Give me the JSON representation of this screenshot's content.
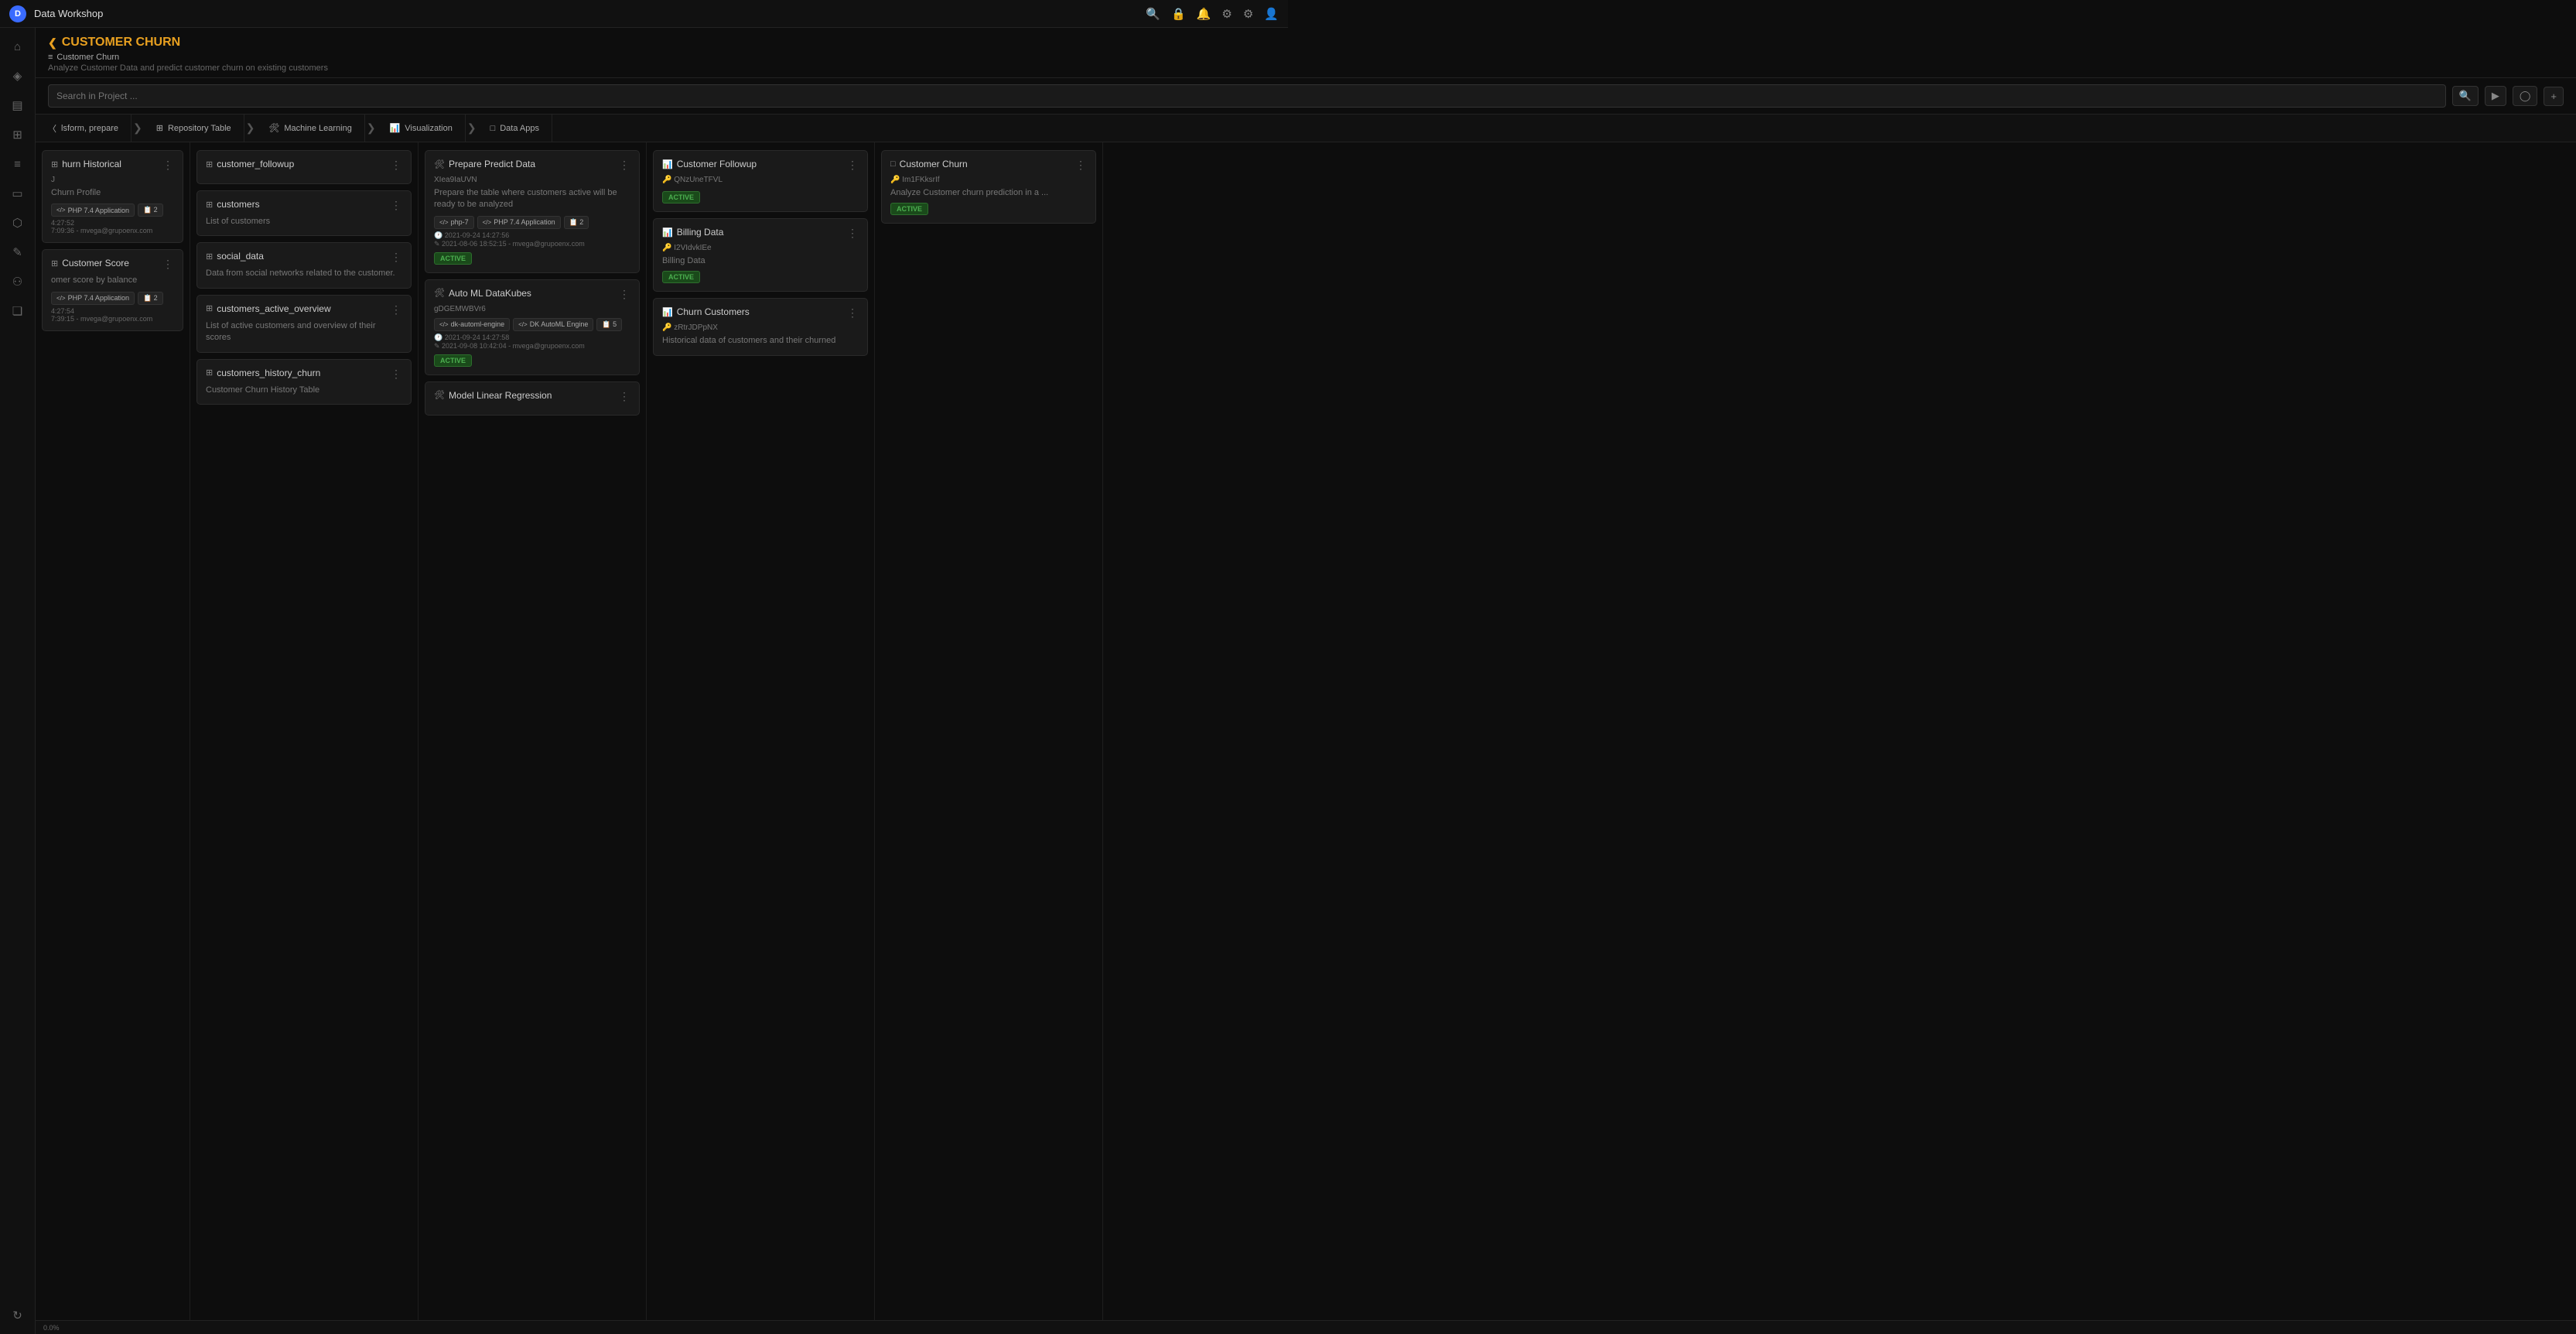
{
  "app": {
    "title": "Data Workshop",
    "logo_letter": "D"
  },
  "topnav": {
    "icons": [
      "search",
      "lock",
      "bell",
      "settings",
      "terminal",
      "user"
    ]
  },
  "sidebar": {
    "items": [
      {
        "name": "home",
        "icon": "⌂"
      },
      {
        "name": "analytics",
        "icon": "◈"
      },
      {
        "name": "storage",
        "icon": "▤"
      },
      {
        "name": "pipelines",
        "icon": "⊞"
      },
      {
        "name": "datasources",
        "icon": "≡"
      },
      {
        "name": "display",
        "icon": "▭"
      },
      {
        "name": "charts",
        "icon": "⬡"
      },
      {
        "name": "tools",
        "icon": "✎"
      },
      {
        "name": "users",
        "icon": "⚇"
      },
      {
        "name": "docs",
        "icon": "❏"
      }
    ]
  },
  "header": {
    "back_label": "CUSTOMER CHURN",
    "project_icon": "≡",
    "project_name": "Customer Churn",
    "description": "Analyze Customer Data and predict customer churn on existing customers"
  },
  "searchbar": {
    "placeholder": "Search in Project ...",
    "btn_run": "▶",
    "btn_history": "⊙",
    "btn_add": "+"
  },
  "pipeline_stages": [
    {
      "icon": "◁",
      "label": "lsform, prepare"
    },
    {
      "icon": "⊞",
      "label": "Repository Table"
    },
    {
      "icon": "🤖",
      "label": "Machine Learning"
    },
    {
      "icon": "📊",
      "label": "Visualization"
    },
    {
      "icon": "▭",
      "label": "Data Apps"
    }
  ],
  "columns": {
    "partial_left": {
      "cards": [
        {
          "title": "hurn Historical",
          "id": "J",
          "badge": "Churn Profile",
          "tags": [
            "PHP 7.4 Application",
            "2"
          ],
          "date": "4:27:52",
          "author": "7:09:36 - mvega@grupoenx.com"
        },
        {
          "title": "Customer Score",
          "id": "",
          "badge": "",
          "desc": "omer score by balance",
          "tags": [
            "PHP 7.4 Application",
            "2"
          ],
          "date": "4:27:54",
          "author": "7:39:15 - mvega@grupoenx.com"
        }
      ]
    },
    "repository_table": {
      "cards": [
        {
          "title": "customer_followup",
          "desc": ""
        },
        {
          "title": "customers",
          "desc": "List of customers"
        },
        {
          "title": "social_data",
          "desc": "Data from social networks related to the customer."
        },
        {
          "title": "customers_active_overview",
          "desc": "List of active customers and overview of their scores"
        },
        {
          "title": "customers_history_churn",
          "desc": "Customer Churn History Table"
        }
      ]
    },
    "machine_learning": {
      "cards": [
        {
          "title": "Prepare Predict Data",
          "id": "XIea9IaUVN",
          "desc": "Prepare the table where customers active will be ready to be analyzed",
          "tags": [
            "php-7",
            "PHP 7.4 Application",
            "2"
          ],
          "date": "2021-09-24 14:27:56",
          "author": "2021-08-06 18:52:15 - mvega@grupoenx.com",
          "status": "ACTIVE"
        },
        {
          "title": "Auto ML DataKubes",
          "id": "gDGEMWBVr6",
          "desc": "",
          "tags": [
            "dk-automl-engine",
            "DK AutoML Engine",
            "5"
          ],
          "date": "2021-09-24 14:27:58",
          "author": "2021-09-08 10:42:04 - mvega@grupoenx.com",
          "status": "ACTIVE"
        },
        {
          "title": "Model Linear Regression",
          "id": "",
          "desc": ""
        }
      ]
    },
    "visualization": {
      "cards": [
        {
          "title": "Customer Followup",
          "id": "QNzUneTFVL",
          "desc": "",
          "status": "ACTIVE"
        },
        {
          "title": "Billing Data",
          "id": "I2VIdvkIEe",
          "desc": "Billing Data",
          "status": "ACTIVE"
        },
        {
          "title": "Churn Customers",
          "id": "zRtrJDPpNX",
          "desc": "Historical data of customers and their churned"
        }
      ]
    },
    "data_apps": {
      "cards": [
        {
          "title": "Customer Churn",
          "id": "Im1FKksrIf",
          "desc": "Analyze Customer churn prediction in a ...",
          "status": "ACTIVE"
        }
      ]
    }
  },
  "status_bar": {
    "progress": "0.0%"
  }
}
